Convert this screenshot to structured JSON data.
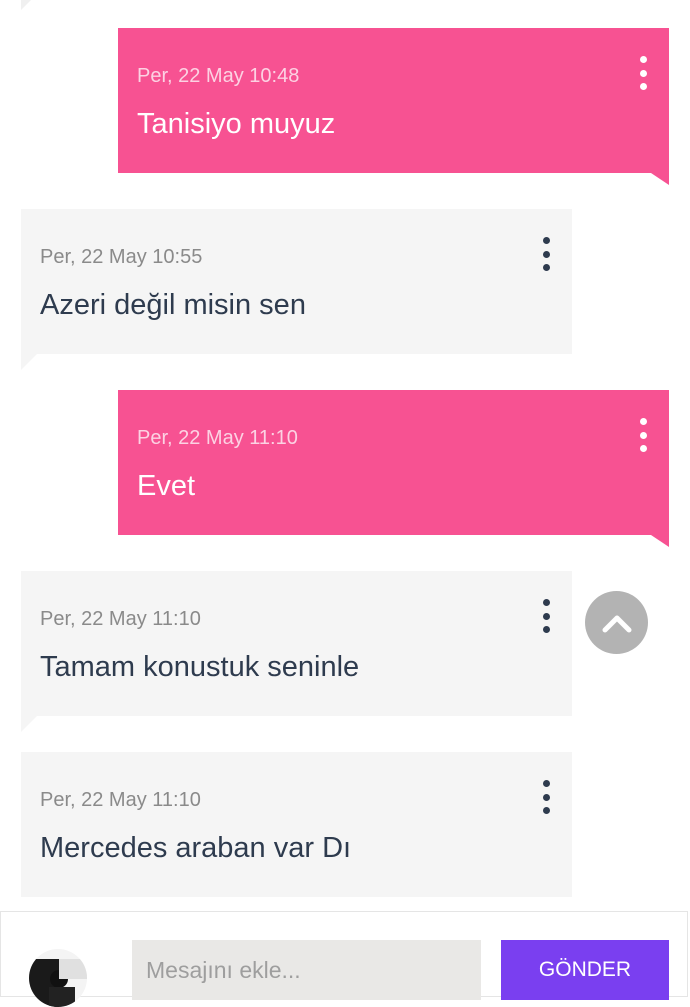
{
  "messages": [
    {
      "direction": "outgoing",
      "time": "Per, 22 May 10:48",
      "text": "Tanisiyo muyuz"
    },
    {
      "direction": "incoming",
      "time": "Per, 22 May 10:55",
      "text": "Azeri değil misin sen"
    },
    {
      "direction": "outgoing",
      "time": "Per, 22 May 11:10",
      "text": "Evet"
    },
    {
      "direction": "incoming",
      "time": "Per, 22 May 11:10",
      "text": "Tamam konustuk seninle"
    },
    {
      "direction": "incoming",
      "time": "Per, 22 May 11:10",
      "text": "Mercedes araban var Dı"
    }
  ],
  "composer": {
    "placeholder": "Mesajını ekle...",
    "value": "",
    "send_label": "GÖNDER"
  },
  "icons": {
    "message_menu": "more-vertical-icon",
    "scroll_top": "chevron-up-icon"
  },
  "colors": {
    "outgoing_bubble": "#f75292",
    "incoming_bubble": "#f5f5f5",
    "send_button": "#7a3ff0",
    "scroll_button": "#b3b3b3"
  }
}
